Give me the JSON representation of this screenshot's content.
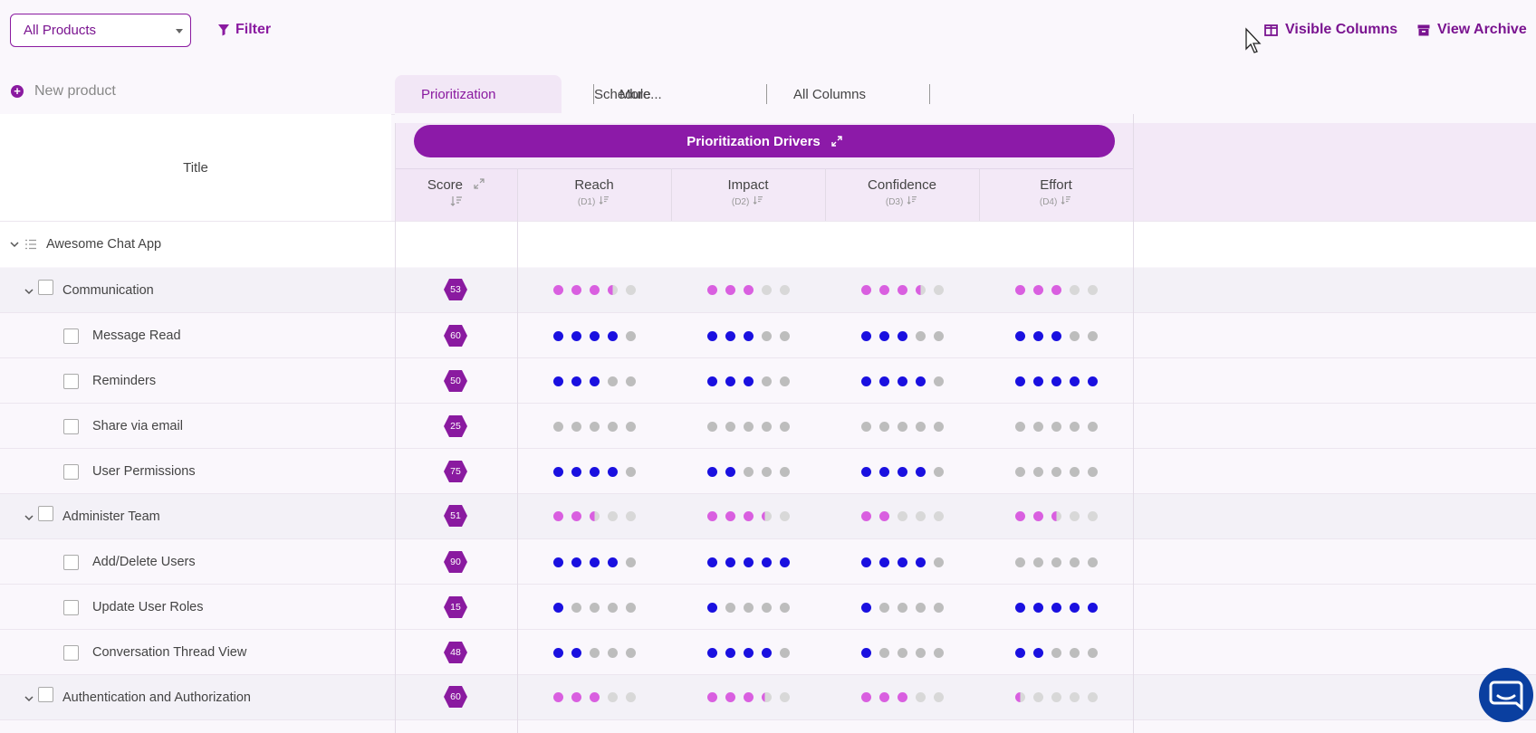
{
  "toolbar": {
    "product_select": "All Products",
    "filter_label": "Filter",
    "visible_columns_label": "Visible Columns",
    "view_archive_label": "View Archive"
  },
  "new_product_label": "New product",
  "tabs": [
    {
      "label": "Prioritization",
      "active": true
    },
    {
      "label": "Schedule",
      "active": false
    },
    {
      "label": "More...",
      "active": false
    },
    {
      "label": "All Columns",
      "active": false
    }
  ],
  "drivers_label": "Prioritization Drivers",
  "columns": {
    "title": "Title",
    "score": "Score",
    "reach": {
      "label": "Reach",
      "sub": "(D1)"
    },
    "impact": {
      "label": "Impact",
      "sub": "(D2)"
    },
    "confidence": {
      "label": "Confidence",
      "sub": "(D3)"
    },
    "effort": {
      "label": "Effort",
      "sub": "(D4)"
    }
  },
  "colors": {
    "brand": "#8a1aa0",
    "dot_group": "#d95fe0",
    "dot_item": "#1a10e0",
    "dot_empty": "#bdbdbd"
  },
  "app_row": {
    "title": "Awesome Chat App"
  },
  "rows": [
    {
      "type": "group",
      "title": "Communication",
      "score": "53",
      "reach": 3.5,
      "impact": 3,
      "confidence": 3.5,
      "effort": 3
    },
    {
      "type": "item",
      "title": "Message Read",
      "score": "60",
      "reach": 4,
      "impact": 3,
      "confidence": 3,
      "effort": 3
    },
    {
      "type": "item",
      "title": "Reminders",
      "score": "50",
      "reach": 3,
      "impact": 3,
      "confidence": 4,
      "effort": 5
    },
    {
      "type": "item",
      "title": "Share via email",
      "score": "25",
      "reach": 0,
      "impact": 0,
      "confidence": 0,
      "effort": 0
    },
    {
      "type": "item",
      "title": "User Permissions",
      "score": "75",
      "reach": 4,
      "impact": 2,
      "confidence": 4,
      "effort": 0
    },
    {
      "type": "group",
      "title": "Administer Team",
      "score": "51",
      "reach": 2.5,
      "impact": 3.3,
      "confidence": 2,
      "effort": 2.5
    },
    {
      "type": "item",
      "title": "Add/Delete Users",
      "score": "90",
      "reach": 4,
      "impact": 5,
      "confidence": 4,
      "effort": 0
    },
    {
      "type": "item",
      "title": "Update User Roles",
      "score": "15",
      "reach": 1,
      "impact": 1,
      "confidence": 1,
      "effort": 5
    },
    {
      "type": "item",
      "title": "Conversation Thread View",
      "score": "48",
      "reach": 2,
      "impact": 4,
      "confidence": 1,
      "effort": 2
    },
    {
      "type": "group",
      "title": "Authentication and Authorization",
      "score": "60",
      "reach": 3,
      "impact": 3.3,
      "confidence": 3,
      "effort": 0.5
    }
  ]
}
